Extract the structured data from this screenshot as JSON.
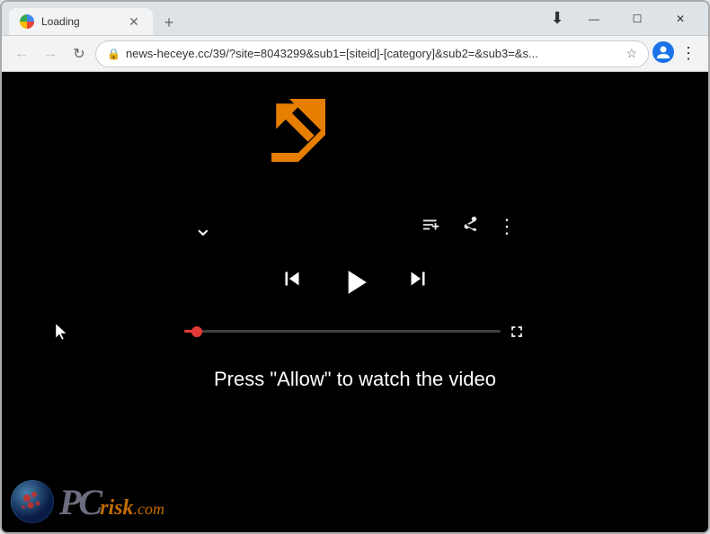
{
  "browser": {
    "tab": {
      "title": "Loading",
      "favicon": "loading-favicon"
    },
    "new_tab_label": "+",
    "window_controls": {
      "minimize": "—",
      "maximize": "☐",
      "close": "✕"
    },
    "nav": {
      "back": "←",
      "forward": "→",
      "refresh": "↻"
    },
    "address": {
      "url": "news-heceye.cc/39/?site=8043299&sub1=[siteid]-[category]&sub2=&sub3=&s...",
      "lock_icon": "🔒"
    },
    "star_icon": "☆",
    "profile_icon": "👤",
    "menu_icon": "⋮"
  },
  "player": {
    "chevron_down": "⌄",
    "add_to_queue": "≡+",
    "share": "↪",
    "more_options": "⋮",
    "skip_back": "⏮",
    "play": "▶",
    "skip_forward": "⏭",
    "fullscreen": "⛶",
    "progress_percent": 4,
    "allow_text": "Press \"Allow\" to watch the video"
  },
  "watermark": {
    "pc_text": "PC",
    "risk_text": "risk",
    "com_text": ".com"
  },
  "colors": {
    "progress_dot": "#e53935",
    "arrow": "#e67e00",
    "background": "#000000",
    "text_white": "#ffffff"
  }
}
